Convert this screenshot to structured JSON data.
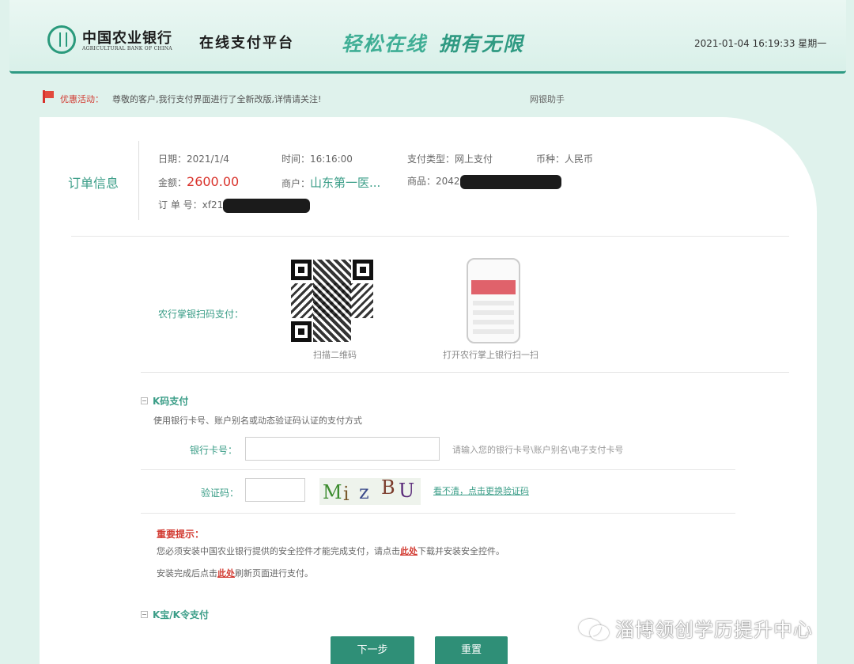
{
  "header": {
    "bank_name_cn": "中国农业银行",
    "bank_name_en": "AGRICULTURAL BANK OF CHINA",
    "platform_name": "在线支付平台",
    "slogan_1": "轻松在线",
    "slogan_2": "拥有无限",
    "datetime": "2021-01-04 16:19:33 星期一"
  },
  "notice": {
    "label": "优惠活动：",
    "text": "尊敬的客户,我行支付界面进行了全新改版,详情请关注!",
    "help": "网银助手"
  },
  "order": {
    "title": "订单信息",
    "date_label": "日期：",
    "date_value": "2021/1/4",
    "time_label": "时间：",
    "time_value": "16:16:00",
    "pay_type_label": "支付类型：",
    "pay_type_value": "网上支付",
    "currency_label": "币种：",
    "currency_value": "人民币",
    "amount_label": "金额：",
    "amount_value": "2600.00",
    "merchant_label": "商户：",
    "merchant_value": "山东第一医...",
    "product_label": "商品：",
    "product_value": "2042",
    "order_no_label": "订 单 号：",
    "order_no_value": "xf21"
  },
  "qr": {
    "label": "农行掌银扫码支付：",
    "scan_caption": "扫描二维码",
    "app_caption": "打开农行掌上银行扫一扫"
  },
  "kpay": {
    "title": "K码支付",
    "description": "使用银行卡号、账户别名或动态验证码认证的支付方式",
    "card_label": "银行卡号：",
    "card_value": "",
    "card_hint": "请输入您的银行卡号\\账户别名\\电子支付卡号",
    "captcha_label": "验证码：",
    "captcha_value": "",
    "captcha_text": "Mi z BU",
    "captcha_refresh": "看不清，点击更换验证码"
  },
  "important": {
    "title": "重要提示：",
    "line1_before": "您必须安装中国农业银行提供的安全控件才能完成支付，请点击",
    "line1_link": "此处",
    "line1_after": "下载并安装安全控件。",
    "line2_before": "安装完成后点击",
    "line2_link": "此处",
    "line2_after": "刷新页面进行支付。"
  },
  "kbao": {
    "title": "K宝/K令支付"
  },
  "buttons": {
    "next": "下一步",
    "reset": "重置"
  },
  "watermark": {
    "text": "淄博领创学历提升中心"
  },
  "colors": {
    "brand_green": "#2f8f77",
    "accent_green": "#3a9d87",
    "alert_red": "#d23b32"
  }
}
